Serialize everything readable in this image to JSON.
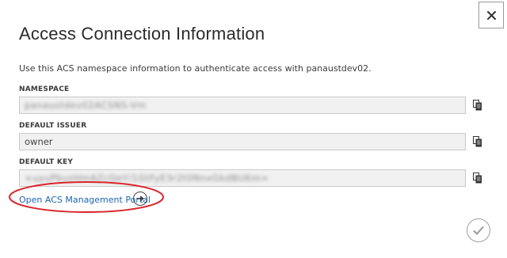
{
  "dialog": {
    "title": "Access Connection Information",
    "description": "Use this ACS namespace information to authenticate access with panaustdev02.",
    "close_icon": "close-icon",
    "confirm_icon": "checkmark-icon"
  },
  "fields": [
    {
      "label": "NAMESPACE",
      "value": "panaustdev02ACSNS-Vm",
      "obscured": true,
      "copy_icon": "copy-icon"
    },
    {
      "label": "DEFAULT ISSUER",
      "value": "owner",
      "obscured": false,
      "copy_icon": "copy-icon"
    },
    {
      "label": "DEFAULT KEY",
      "value": "+uyuPbvzHmAZcQeY/1GtFyE3r2t0NnxGkdBUKm=",
      "obscured": true,
      "copy_icon": "copy-icon"
    }
  ],
  "portal": {
    "link_text": "Open ACS Management Portal",
    "arrow_icon": "arrow-right-circle-icon"
  },
  "colors": {
    "link": "#1a66b3",
    "annotation": "#d9262b",
    "field_bg": "#f1f1f1"
  }
}
